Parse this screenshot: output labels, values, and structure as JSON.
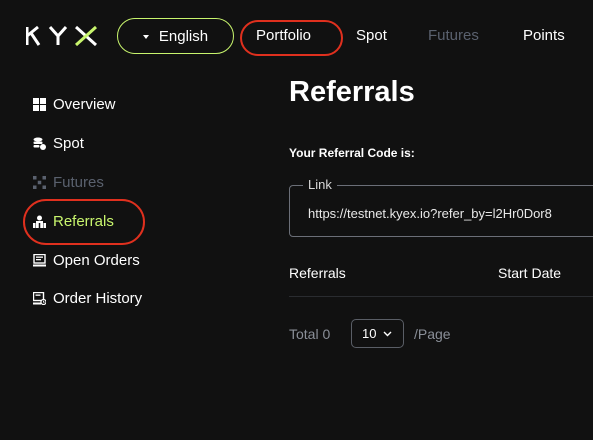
{
  "header": {
    "logo_text": "KYX",
    "language": "English",
    "nav": [
      {
        "label": "Portfolio"
      },
      {
        "label": "Spot"
      },
      {
        "label": "Futures"
      },
      {
        "label": "Points"
      }
    ]
  },
  "sidebar": {
    "items": [
      {
        "label": "Overview",
        "icon": "grid-icon"
      },
      {
        "label": "Spot",
        "icon": "coins-icon"
      },
      {
        "label": "Futures",
        "icon": "dots-grid-icon"
      },
      {
        "label": "Referrals",
        "icon": "users-icon"
      },
      {
        "label": "Open Orders",
        "icon": "monitor-icon"
      },
      {
        "label": "Order History",
        "icon": "history-icon"
      }
    ]
  },
  "main": {
    "title": "Referrals",
    "code_label": "Your Referral Code is:",
    "link": {
      "label": "Link",
      "value": "https://testnet.kyex.io?refer_by=l2Hr0Dor8"
    },
    "table": {
      "columns": [
        "Referrals",
        "Start Date"
      ]
    },
    "pagination": {
      "total": "Total 0",
      "page_size": "10",
      "per_page": "/Page"
    }
  },
  "colors": {
    "background": "#111111",
    "accent": "#c8f56d",
    "highlight_ring": "#e0301e",
    "disabled_text": "#5a616e"
  }
}
